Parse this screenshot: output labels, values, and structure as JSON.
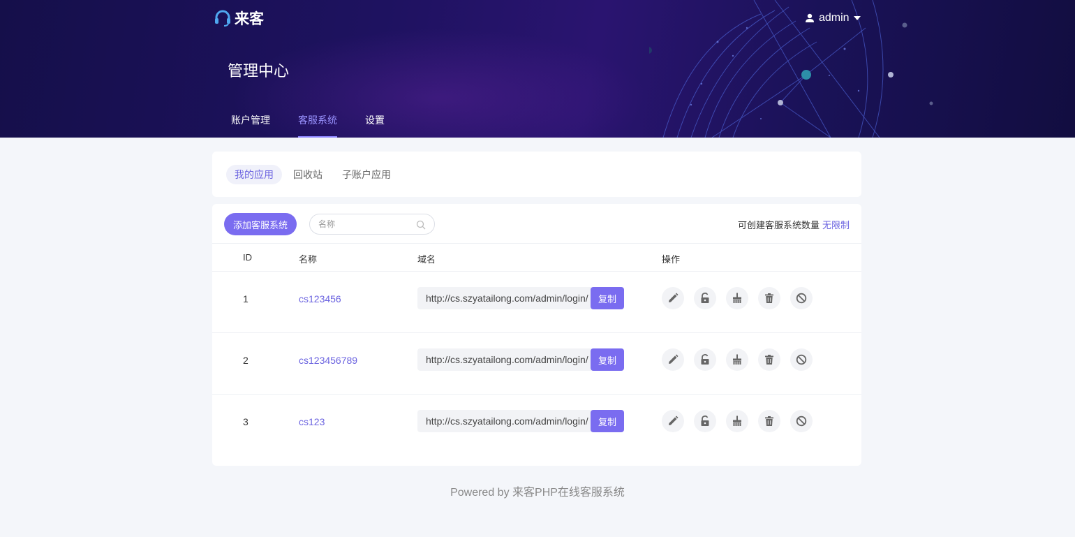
{
  "brand": {
    "name": "来客"
  },
  "user": {
    "name": "admin"
  },
  "page_title": "管理中心",
  "main_tabs": [
    {
      "label": "账户管理",
      "active": false
    },
    {
      "label": "客服系统",
      "active": true
    },
    {
      "label": "设置",
      "active": false
    }
  ],
  "sub_tabs": [
    {
      "label": "我的应用",
      "active": true
    },
    {
      "label": "回收站",
      "active": false
    },
    {
      "label": "子账户应用",
      "active": false
    }
  ],
  "toolbar": {
    "add_label": "添加客服系统",
    "search_placeholder": "名称",
    "search_value": "",
    "quota_label": "可创建客服系统数量",
    "quota_value": "无限制"
  },
  "table": {
    "headers": {
      "id": "ID",
      "name": "名称",
      "domain": "域名",
      "actions": "操作"
    },
    "copy_label": "复制",
    "rows": [
      {
        "id": "1",
        "name": "cs123456",
        "domain": "http://cs.szyatailong.com/admin/login/"
      },
      {
        "id": "2",
        "name": "cs123456789",
        "domain": "http://cs.szyatailong.com/admin/login/"
      },
      {
        "id": "3",
        "name": "cs123",
        "domain": "http://cs.szyatailong.com/admin/login/"
      }
    ],
    "row_actions": [
      "edit-icon",
      "unlock-icon",
      "clear-cache-icon",
      "delete-icon",
      "disable-icon"
    ]
  },
  "footer": {
    "text": "Powered by 来客PHP在线客服系统"
  },
  "colors": {
    "accent": "#7a6cf0",
    "link": "#6b63e0",
    "header_bg": "#1e1260",
    "page_bg": "#f4f6fa"
  }
}
